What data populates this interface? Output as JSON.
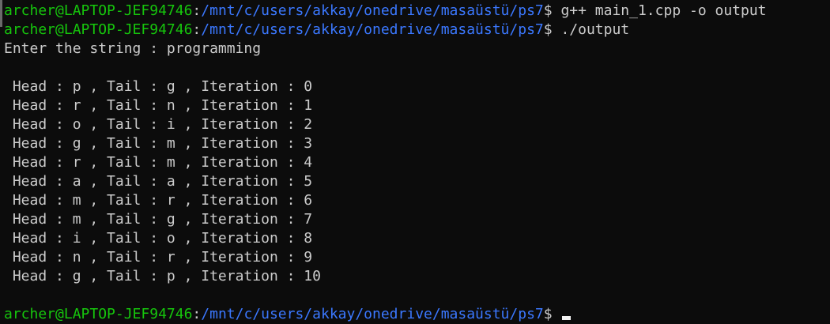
{
  "prompt": {
    "user_host": "archer@LAPTOP-JEF94746",
    "separator": ":",
    "path": "/mnt/c/users/akkay/onedrive/masaüstü/ps7",
    "symbol": "$ "
  },
  "commands": [
    "g++ main_1.cpp -o output",
    "./output"
  ],
  "output": {
    "input_prompt": "Enter the string : programming",
    "blank": "",
    "rows": [
      " Head : p , Tail : g , Iteration : 0",
      " Head : r , Tail : n , Iteration : 1",
      " Head : o , Tail : i , Iteration : 2",
      " Head : g , Tail : m , Iteration : 3",
      " Head : r , Tail : m , Iteration : 4",
      " Head : a , Tail : a , Iteration : 5",
      " Head : m , Tail : r , Iteration : 6",
      " Head : m , Tail : g , Iteration : 7",
      " Head : i , Tail : o , Iteration : 8",
      " Head : n , Tail : r , Iteration : 9",
      " Head : g , Tail : p , Iteration : 10"
    ]
  },
  "colors": {
    "background": "#0c0c0c",
    "text": "#cccccc",
    "user_host": "#16c60c",
    "path": "#3b78ff"
  }
}
